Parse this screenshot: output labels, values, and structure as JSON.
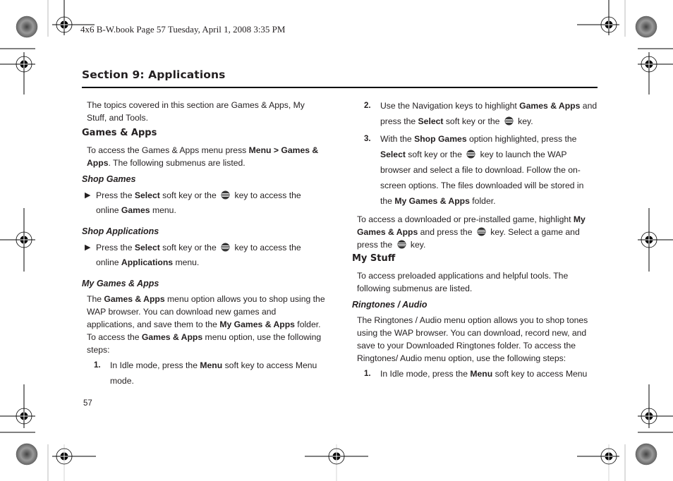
{
  "header": {
    "print_line": "4x6 B-W.book  Page 57  Tuesday, April 1, 2008  3:35 PM"
  },
  "section_title": "Section 9: Applications",
  "left_column": {
    "intro": "The topics covered in this section are Games & Apps, My Stuff, and Tools.",
    "games_apps_heading": "Games & Apps",
    "games_apps_intro_pre": "To access the Games & Apps menu press ",
    "games_apps_intro_bold": "Menu > Games & Apps",
    "games_apps_intro_post": ". The following submenus are listed.",
    "shop_games_heading": "Shop Games",
    "shop_games_bullet": {
      "pre": "Press the ",
      "bold1": "Select",
      "mid": " soft key or the ",
      "post": " key to access the online ",
      "bold2": "Games",
      "end": " menu."
    },
    "shop_apps_heading": "Shop Applications",
    "shop_apps_bullet": {
      "pre": "Press the ",
      "bold1": "Select",
      "mid": " soft key or the ",
      "post": " key to access the online ",
      "bold2": "Applications",
      "end": " menu."
    },
    "my_games_heading": "My Games & Apps",
    "my_games_para": {
      "t1": "The ",
      "b1": "Games & Apps",
      "t2": " menu option allows you to shop using the WAP browser. You can download new games and applications, and save them to the ",
      "b2": "My Games & Apps",
      "t3": " folder. To access the ",
      "b3": "Games & Apps",
      "t4": " menu option, use the following steps:"
    },
    "step1": {
      "num": "1.",
      "pre": "In Idle mode, press the ",
      "bold": "Menu",
      "post": " soft key to access Menu mode."
    }
  },
  "right_column": {
    "step2": {
      "num": "2.",
      "pre": "Use the Navigation keys to highlight ",
      "bold1": "Games & Apps",
      "mid": " and press the ",
      "bold2": "Select",
      "mid2": " soft key or the ",
      "end": " key."
    },
    "step3": {
      "num": "3.",
      "pre": "With the ",
      "bold1": "Shop Games",
      "mid": " option highlighted, press the ",
      "bold2": "Select",
      "mid2": " soft key or the ",
      "mid3": " key to launch the WAP browser and select a file to download. Follow the on-screen options. The files downloaded will be stored in the ",
      "bold3": "My Games & Apps",
      "end": " folder."
    },
    "access_para": {
      "pre": "To access a downloaded or pre-installed game, highlight ",
      "bold": "My Games & Apps",
      "mid": " and press the ",
      "mid2": " key. Select a game and press the ",
      "end": " key."
    },
    "my_stuff_heading": "My Stuff",
    "my_stuff_intro": "To access preloaded applications and helpful tools. The following submenus are listed.",
    "ringtones_heading": "Ringtones / Audio",
    "ringtones_para": "The Ringtones / Audio menu option allows you to shop tones using the WAP browser. You can download, record new, and save to your Downloaded Ringtones folder. To access the Ringtones/ Audio menu option, use the following steps:",
    "step1": {
      "num": "1.",
      "pre": "In Idle mode, press the ",
      "bold": "Menu",
      "post": " soft key to access Menu"
    }
  },
  "footer": {
    "page_number": "57"
  },
  "icons": {
    "key_icon": "att-globe-key-icon",
    "bullet_icon": "triangle-right"
  }
}
